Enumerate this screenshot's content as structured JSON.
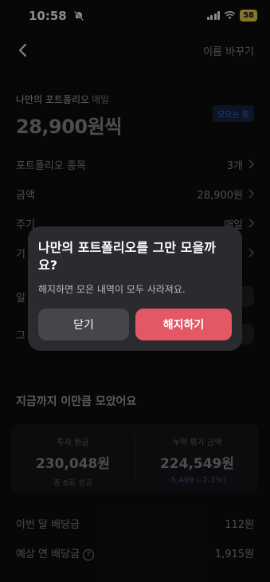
{
  "status_bar": {
    "time": "10:58",
    "battery": "58"
  },
  "nav": {
    "rename_label": "이름 바꾸기"
  },
  "portfolio": {
    "name": "나만의 포트폴리오",
    "frequency": "매일",
    "amount": "28,900원씩",
    "status_badge": "모으는 중"
  },
  "info_rows": [
    {
      "label": "포트폴리오 종목",
      "value": "3개"
    },
    {
      "label": "금액",
      "value": "28,900원"
    },
    {
      "label": "주기",
      "value": "매일"
    },
    {
      "label": "기"
    },
    {
      "label": "일"
    },
    {
      "label": "그"
    }
  ],
  "summary": {
    "title": "지금까지 이만큼 모았어요",
    "principal_label": "투자 원금",
    "principal_value": "230,048원",
    "principal_sub": "총 8회 성공",
    "valuation_label": "누적 평가 금액",
    "valuation_value": "224,549원",
    "valuation_sub": "-5,499 (-2.3%)"
  },
  "dividends": {
    "monthly_label": "이번 달 배당금",
    "monthly_value": "112원",
    "yearly_label": "예상 연 배당금",
    "yearly_value": "1,915원"
  },
  "dialog": {
    "title": "나만의 포트폴리오를 그만 모을까요?",
    "body": "해지하면 모은 내역이 모두 사라져요.",
    "close_label": "닫기",
    "cancel_label": "해지하기"
  },
  "colors": {
    "accent_red": "#e25865",
    "badge_blue": "#4d76c5",
    "battery_yellow": "#f2d74a"
  }
}
